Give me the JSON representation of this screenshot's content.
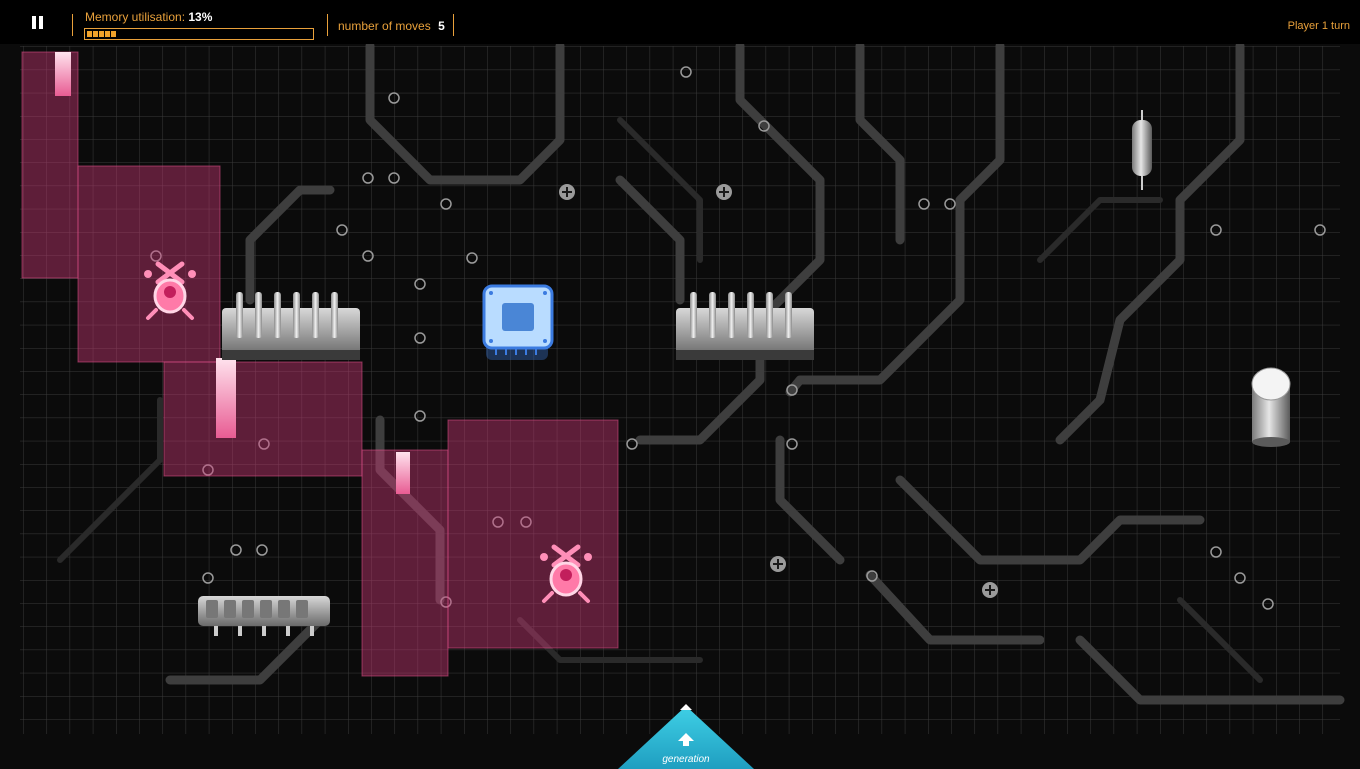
{
  "hud": {
    "pause_icon": "pause-icon",
    "memory_label": "Memory utilisation:",
    "memory_value": "13%",
    "memory_fraction": 0.13,
    "moves_label": "number of moves",
    "moves_value": "5",
    "turn_label": "Player 1 turn",
    "accent_color": "#e9a13b"
  },
  "board": {
    "territory_color": "#d23a7a",
    "pieces": [
      {
        "name": "player-virus-1",
        "icon": "virus-creature-icon"
      },
      {
        "name": "player-virus-2",
        "icon": "virus-creature-icon"
      },
      {
        "name": "cpu-chip",
        "icon": "cpu-chip-icon"
      },
      {
        "name": "heatsink-left",
        "icon": "heatsink-icon"
      },
      {
        "name": "heatsink-right",
        "icon": "heatsink-icon"
      },
      {
        "name": "memory-chip",
        "icon": "ram-chip-icon"
      },
      {
        "name": "capacitor",
        "icon": "capacitor-icon"
      },
      {
        "name": "resistor",
        "icon": "resistor-icon"
      }
    ]
  },
  "generation_button": {
    "label": "generation",
    "icon": "arrow-up-icon",
    "color": "#2ab6d2"
  }
}
